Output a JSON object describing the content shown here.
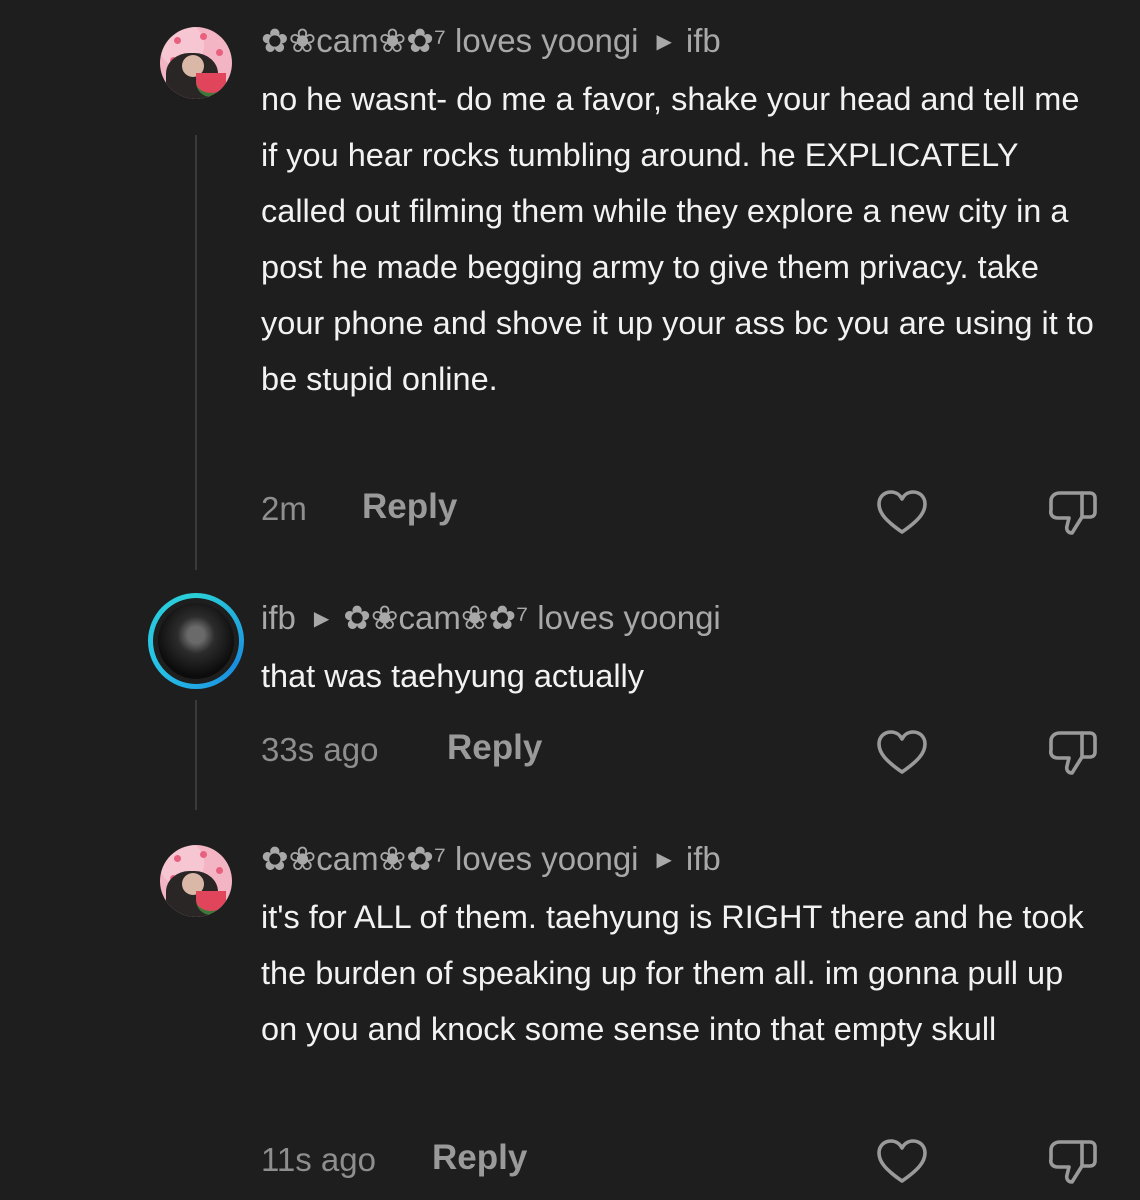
{
  "colors": {
    "background": "#1e1e1e",
    "text_primary": "#f2f2f2",
    "text_secondary": "#a8a8a8",
    "story_ring": "#2ad0d8"
  },
  "comments": [
    {
      "author": "✿❀cam❀✿⁷ loves yoongi",
      "reply_to": "ifb",
      "text": "no he wasnt- do me a favor, shake your head and tell me if you hear rocks tumbling around. he EXPLICATELY called out filming them while they explore a new city in a post he made begging army to give them privacy. take your phone and shove it up your ass bc you are using it to be stupid online.",
      "time": "2m",
      "reply_label": "Reply",
      "like_icon": "heart-icon",
      "dislike_icon": "thumbs-down-icon"
    },
    {
      "author": "ifb",
      "reply_to": "✿❀cam❀✿⁷ loves yoongi",
      "text": "that was taehyung actually",
      "time": "33s ago",
      "reply_label": "Reply",
      "like_icon": "heart-icon",
      "dislike_icon": "thumbs-down-icon"
    },
    {
      "author": "✿❀cam❀✿⁷ loves yoongi",
      "reply_to": "ifb",
      "text": "it's for ALL of them. taehyung is RIGHT there and he took the burden of speaking up for them all. im gonna pull up on you and knock some sense into that empty skull",
      "time": "11s ago",
      "reply_label": "Reply",
      "like_icon": "heart-icon",
      "dislike_icon": "thumbs-down-icon"
    }
  ],
  "icons": {
    "arrow": "▶"
  }
}
